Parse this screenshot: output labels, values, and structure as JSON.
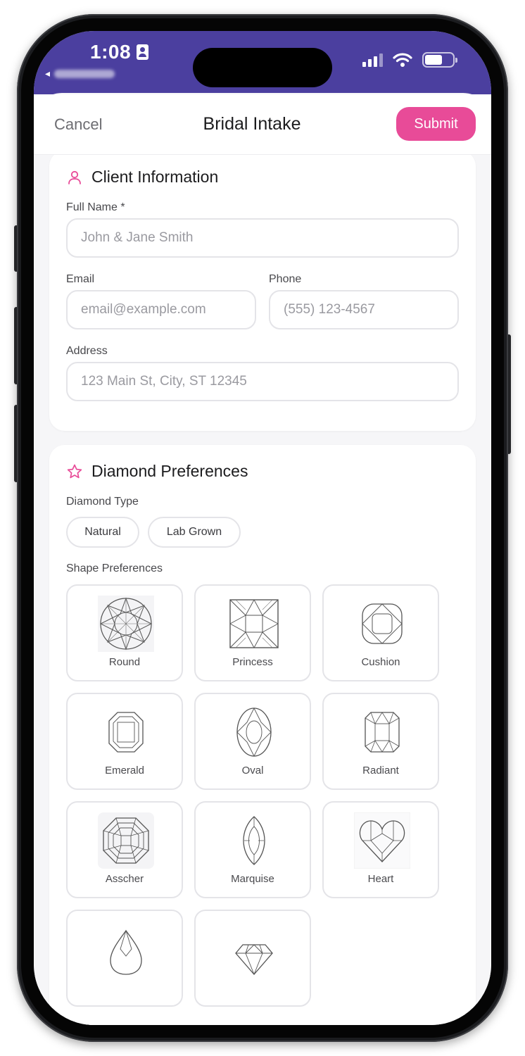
{
  "status_bar": {
    "time": "1:08",
    "background": "#4b3f9f"
  },
  "nav": {
    "cancel_label": "Cancel",
    "title": "Bridal Intake",
    "submit_label": "Submit",
    "accent": "#e84b98"
  },
  "client_info": {
    "title": "Client Information",
    "icon": "person-icon",
    "full_name": {
      "label": "Full Name *",
      "placeholder": "John & Jane Smith"
    },
    "email": {
      "label": "Email",
      "placeholder": "email@example.com"
    },
    "phone": {
      "label": "Phone",
      "placeholder": "(555) 123-4567"
    },
    "address": {
      "label": "Address",
      "placeholder": "123 Main St, City, ST 12345"
    }
  },
  "diamond_prefs": {
    "title": "Diamond Preferences",
    "icon": "star-icon",
    "type_label": "Diamond Type",
    "types": [
      "Natural",
      "Lab Grown"
    ],
    "shape_label": "Shape Preferences",
    "shapes": [
      "Round",
      "Princess",
      "Cushion",
      "Emerald",
      "Oval",
      "Radiant",
      "Asscher",
      "Marquise",
      "Heart",
      "",
      ""
    ]
  }
}
